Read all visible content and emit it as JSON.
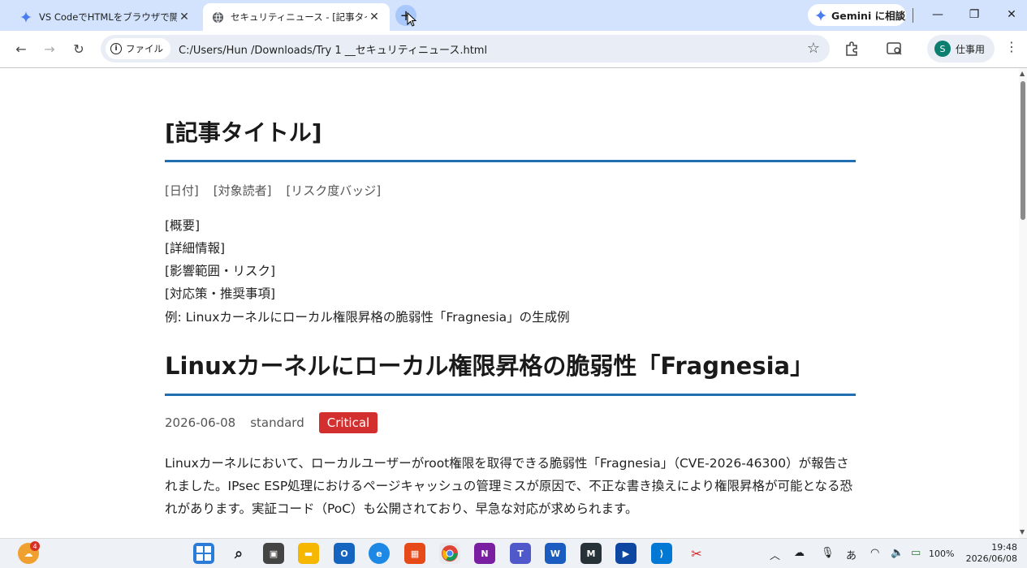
{
  "browser": {
    "tabs": [
      {
        "title": "VS CodeでHTMLをブラウザで開く方"
      },
      {
        "title": "セキュリティニュース - [記事タイトル]"
      }
    ],
    "gemini_label": "Gemini に相談",
    "address": {
      "scheme_chip": "ファイル",
      "url": "C:/Users/Hun                 /Downloads/Try 1 __セキュリティニュース.html"
    },
    "profile_initial": "S",
    "profile_label": "仕事用"
  },
  "template": {
    "title": "[記事タイトル]",
    "meta": [
      "[日付]",
      "[対象読者]",
      "[リスク度バッジ]"
    ],
    "sections": [
      "[概要]",
      "[詳細情報]",
      "[影響範囲・リスク]",
      "[対応策・推奨事項]"
    ],
    "example_note": "例: Linuxカーネルにローカル権限昇格の脆弱性「Fragnesia」の生成例"
  },
  "article": {
    "title": "Linuxカーネルにローカル権限昇格の脆弱性「Fragnesia」",
    "date": "2026-06-08",
    "audience": "standard",
    "risk_badge": "Critical",
    "risk_color": "#d32f2f",
    "summary": "Linuxカーネルにおいて、ローカルユーザーがroot権限を取得できる脆弱性「Fragnesia」（CVE-2026-46300）が報告されました。IPsec ESP処理におけるページキャッシュの管理ミスが原因で、不正な書き換えにより権限昇格が可能となる恐れがあります。実証コード（PoC）も公開されており、早急な対応が求められます。"
  },
  "accent_color": "#1f6fb2",
  "taskbar": {
    "weather_badge": "4",
    "battery": "100%",
    "ime": "あ",
    "time": "19:48",
    "date": "2026/06/08"
  }
}
